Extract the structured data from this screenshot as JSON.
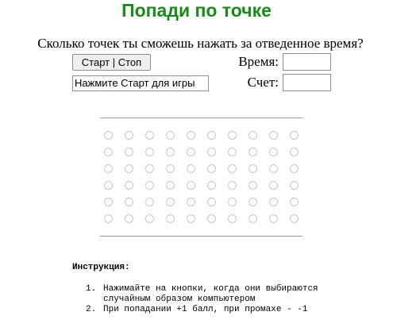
{
  "title": "Попади по точке",
  "subtitle": "Сколько точек ты сможешь нажать за отведенное время?",
  "controls": {
    "start_stop_label": "Старт | Стоп",
    "status_text": "Нажмите Старт для игры",
    "time_label": "Время:",
    "time_value": "",
    "score_label": "Счет:",
    "score_value": ""
  },
  "board": {
    "rows": 6,
    "cols": 10,
    "dot_color": "#c8c8c8"
  },
  "instructions": {
    "heading": "Инструкция:",
    "items": [
      {
        "num": "1.",
        "text": "Нажимайте на кнопки, когда они выбираются случайным образом компьютером"
      },
      {
        "num": "2.",
        "text": "При попадании +1 балл, при промахе - -1"
      }
    ]
  },
  "colors": {
    "title": "#1a8a1a"
  }
}
